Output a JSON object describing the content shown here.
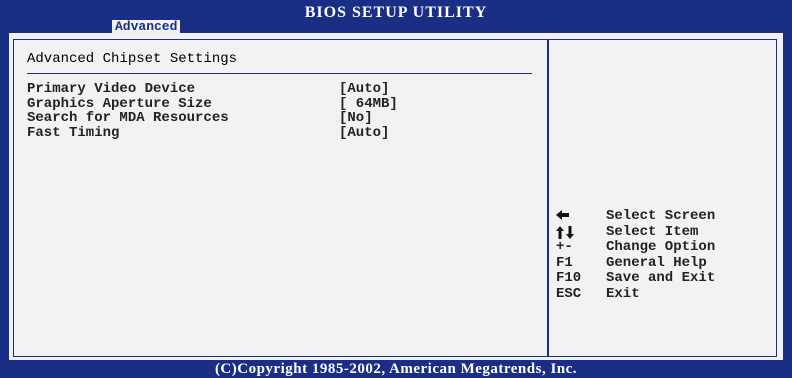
{
  "header": {
    "title": "BIOS SETUP UTILITY",
    "active_tab": "Advanced"
  },
  "section": {
    "title": "Advanced Chipset Settings"
  },
  "settings": [
    {
      "label": "Primary Video Device",
      "value": "[Auto]"
    },
    {
      "label": "Graphics Aperture Size",
      "value": "[ 64MB]"
    },
    {
      "label": "Search for MDA Resources",
      "value": "[No]"
    },
    {
      "label": "Fast Timing",
      "value": "[Auto]"
    }
  ],
  "help": [
    {
      "key_icon": "left-arrow-icon",
      "key": "",
      "desc": "Select Screen"
    },
    {
      "key_icon": "up-down-arrows-icon",
      "key": "",
      "desc": "Select Item"
    },
    {
      "key": "+-",
      "desc": "Change Option"
    },
    {
      "key": "F1",
      "desc": "General Help"
    },
    {
      "key": "F10",
      "desc": "Save and Exit"
    },
    {
      "key": "ESC",
      "desc": "Exit"
    }
  ],
  "footer": {
    "copyright": "(C)Copyright 1985-2002, American Megatrends, Inc."
  },
  "colors": {
    "background": "#1a2e86",
    "panel": "#f2f2f2",
    "text": "#222222",
    "header_text": "#ffffff"
  }
}
